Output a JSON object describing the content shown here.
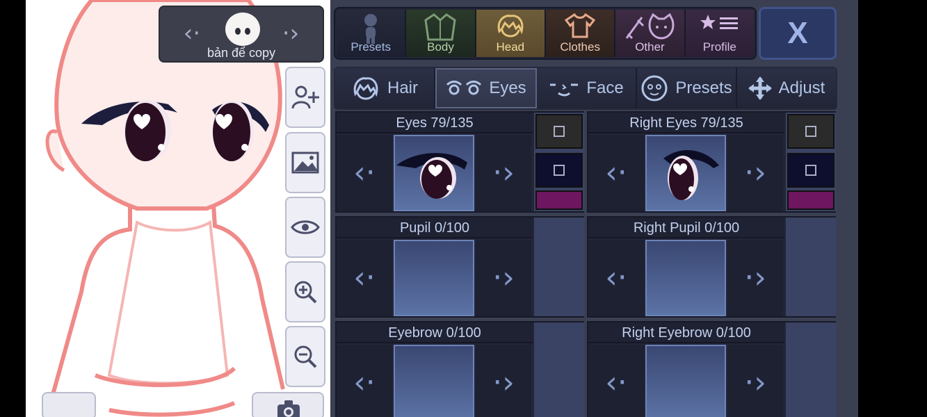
{
  "character": {
    "name": "bản để copy"
  },
  "top_tabs": [
    {
      "label": "Presets",
      "icon": "person-silhouette-icon"
    },
    {
      "label": "Body",
      "icon": "jacket-icon"
    },
    {
      "label": "Head",
      "icon": "hair-head-icon"
    },
    {
      "label": "Clothes",
      "icon": "shirt-icon"
    },
    {
      "label": "Other",
      "icon": "sword-cat-icon"
    },
    {
      "label": "Profile",
      "icon": "star-list-icon"
    }
  ],
  "active_top_tab": "Head",
  "close_label": "X",
  "sub_tabs": [
    {
      "label": "Hair",
      "icon": "hair-icon"
    },
    {
      "label": "Eyes",
      "icon": "eyes-icon"
    },
    {
      "label": "Face",
      "icon": "face-icon"
    },
    {
      "label": "Presets",
      "icon": "smiley-face-icon"
    },
    {
      "label": "Adjust",
      "icon": "move-arrows-icon"
    }
  ],
  "active_sub_tab": "Eyes",
  "slots": {
    "eyes": {
      "title": "Eyes 79/135"
    },
    "right_eyes": {
      "title": "Right Eyes 79/135"
    },
    "pupil": {
      "title": "Pupil 0/100"
    },
    "right_pupil": {
      "title": "Right Pupil 0/100"
    },
    "eyebrow": {
      "title": "Eyebrow 0/100"
    },
    "right_eyebrow": {
      "title": "Right Eyebrow 0/100"
    }
  },
  "colors": {
    "eye_color_1": "#2b2b2b",
    "eye_color_2": "#0e0e2e",
    "eye_accent": "#6e1660",
    "skin": "#fdecea",
    "outline": "#f08a88"
  }
}
